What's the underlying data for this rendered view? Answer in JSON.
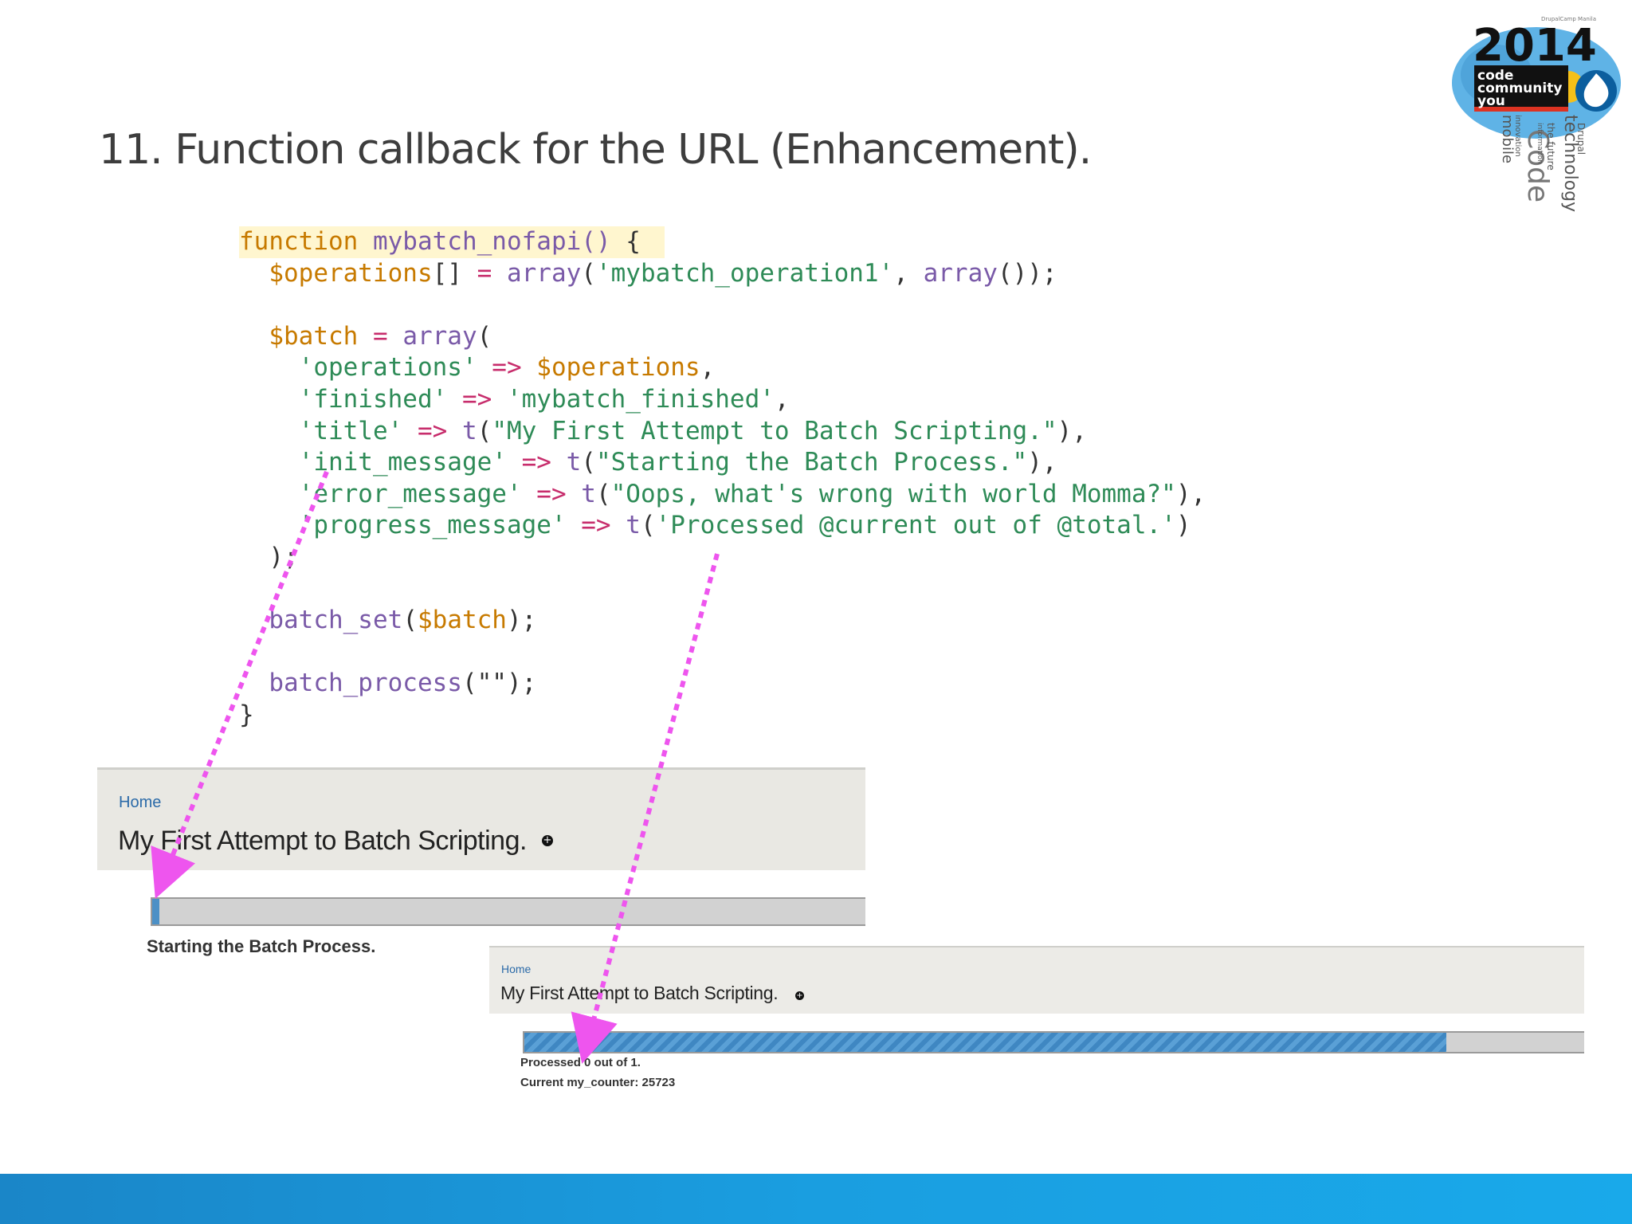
{
  "slide": {
    "title": "11. Function callback for the URL (Enhancement)."
  },
  "logo": {
    "year": "2014",
    "words": [
      "code",
      "community",
      "you"
    ],
    "tag_words": [
      "mobile",
      "innovation",
      "Code",
      "information",
      "the future",
      "technology",
      "Drupal"
    ],
    "small_text": "DrupalCamp Manila"
  },
  "code": {
    "lines": [
      [
        {
          "t": "function ",
          "c": "kw"
        },
        {
          "t": "mybatch_nofapi()",
          "c": "fn"
        },
        {
          "t": " {",
          "c": "pl"
        }
      ],
      [
        {
          "t": "  ",
          "c": "pl"
        },
        {
          "t": "$operations",
          "c": "var"
        },
        {
          "t": "[]",
          "c": "pl"
        },
        {
          "t": " = ",
          "c": "op"
        },
        {
          "t": "array",
          "c": "fn"
        },
        {
          "t": "(",
          "c": "pl"
        },
        {
          "t": "'mybatch_operation1'",
          "c": "str"
        },
        {
          "t": ", ",
          "c": "pl"
        },
        {
          "t": "array",
          "c": "fn"
        },
        {
          "t": "());",
          "c": "pl"
        }
      ],
      [
        {
          "t": "",
          "c": "pl"
        }
      ],
      [
        {
          "t": "  ",
          "c": "pl"
        },
        {
          "t": "$batch",
          "c": "var"
        },
        {
          "t": " = ",
          "c": "op"
        },
        {
          "t": "array",
          "c": "fn"
        },
        {
          "t": "(",
          "c": "pl"
        }
      ],
      [
        {
          "t": "    ",
          "c": "pl"
        },
        {
          "t": "'operations'",
          "c": "str"
        },
        {
          "t": " => ",
          "c": "op"
        },
        {
          "t": "$operations",
          "c": "var"
        },
        {
          "t": ",",
          "c": "pl"
        }
      ],
      [
        {
          "t": "    ",
          "c": "pl"
        },
        {
          "t": "'finished'",
          "c": "str"
        },
        {
          "t": " => ",
          "c": "op"
        },
        {
          "t": "'mybatch_finished'",
          "c": "str"
        },
        {
          "t": ",",
          "c": "pl"
        }
      ],
      [
        {
          "t": "    ",
          "c": "pl"
        },
        {
          "t": "'title'",
          "c": "str"
        },
        {
          "t": " => ",
          "c": "op"
        },
        {
          "t": "t",
          "c": "fn"
        },
        {
          "t": "(",
          "c": "pl"
        },
        {
          "t": "\"My First Attempt to Batch Scripting.\"",
          "c": "str"
        },
        {
          "t": "),",
          "c": "pl"
        }
      ],
      [
        {
          "t": "    ",
          "c": "pl"
        },
        {
          "t": "'init_message'",
          "c": "str"
        },
        {
          "t": " => ",
          "c": "op"
        },
        {
          "t": "t",
          "c": "fn"
        },
        {
          "t": "(",
          "c": "pl"
        },
        {
          "t": "\"Starting the Batch Process.\"",
          "c": "str"
        },
        {
          "t": "),",
          "c": "pl"
        }
      ],
      [
        {
          "t": "    ",
          "c": "pl"
        },
        {
          "t": "'error_message'",
          "c": "str"
        },
        {
          "t": " => ",
          "c": "op"
        },
        {
          "t": "t",
          "c": "fn"
        },
        {
          "t": "(",
          "c": "pl"
        },
        {
          "t": "\"Oops, what's wrong with world Momma?\"",
          "c": "str"
        },
        {
          "t": "),",
          "c": "pl"
        }
      ],
      [
        {
          "t": "    ",
          "c": "pl"
        },
        {
          "t": "'progress_message'",
          "c": "str"
        },
        {
          "t": " => ",
          "c": "op"
        },
        {
          "t": "t",
          "c": "fn"
        },
        {
          "t": "(",
          "c": "pl"
        },
        {
          "t": "'Processed @current out of @total.'",
          "c": "str"
        },
        {
          "t": ")",
          "c": "pl"
        }
      ],
      [
        {
          "t": "  );",
          "c": "pl"
        }
      ],
      [
        {
          "t": "",
          "c": "pl"
        }
      ],
      [
        {
          "t": "  ",
          "c": "pl"
        },
        {
          "t": "batch_set",
          "c": "fn"
        },
        {
          "t": "(",
          "c": "pl"
        },
        {
          "t": "$batch",
          "c": "var"
        },
        {
          "t": ");",
          "c": "pl"
        }
      ],
      [
        {
          "t": "",
          "c": "pl"
        }
      ],
      [
        {
          "t": "  ",
          "c": "pl"
        },
        {
          "t": "batch_process",
          "c": "fn"
        },
        {
          "t": "(\"\");",
          "c": "pl"
        }
      ],
      [
        {
          "t": "}",
          "c": "pl"
        }
      ]
    ]
  },
  "screenshot1": {
    "breadcrumb": "Home",
    "page_title": "My First Attempt to Batch Scripting.",
    "progress": 0.01,
    "message": "Starting the Batch Process."
  },
  "screenshot2": {
    "breadcrumb": "Home",
    "page_title": "My First Attempt to Batch Scripting.",
    "progress": 0.87,
    "message1": "Processed 0 out of 1.",
    "message2": "Current my_counter: 25723"
  },
  "colors": {
    "arrow": "#ee55ee",
    "footer": "#1a9ee0",
    "progress_fill": "#4c90c6"
  }
}
